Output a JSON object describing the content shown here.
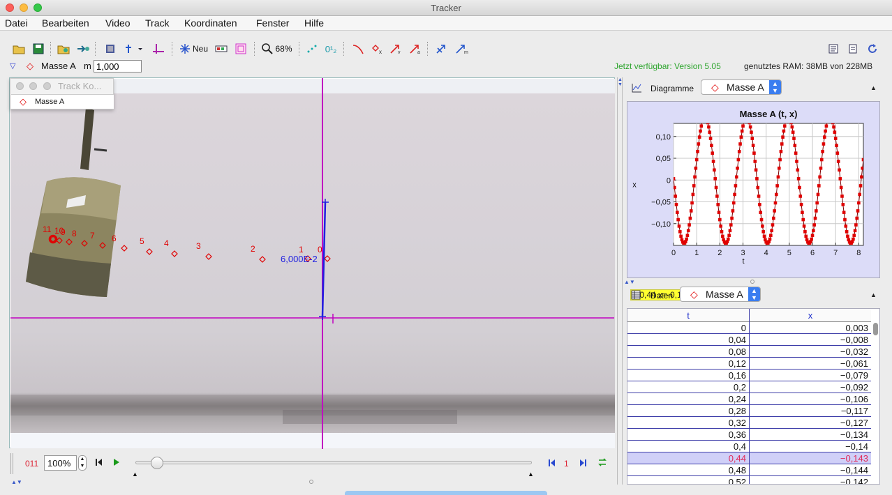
{
  "window": {
    "title": "Tracker"
  },
  "menu": [
    "Datei",
    "Bearbeiten",
    "Video",
    "Track",
    "Koordinaten",
    "Fenster",
    "Hilfe"
  ],
  "toolbar": {
    "new_label": "Neu",
    "zoom_label": "68%"
  },
  "trackbar": {
    "track_name": "Masse A",
    "mass_label": "m",
    "mass_value": "1,000",
    "update_text": "Jetzt verfügbar: Version 5.05",
    "ram_text": "genutztes RAM: 38MB von 228MB"
  },
  "track_control": {
    "title": "Track Ko...",
    "item": "Masse A"
  },
  "video": {
    "point_labels": [
      "11",
      "10",
      "9",
      "8",
      "7",
      "6",
      "5",
      "4",
      "3",
      "2",
      "1",
      "0"
    ],
    "calibration_label": "6,000E-2"
  },
  "player": {
    "frame": "011",
    "zoom": "100%",
    "step": "1"
  },
  "plot_panel": {
    "label": "Diagramme",
    "track": "Masse A",
    "readout": "t=0,44  x=-0,14"
  },
  "table_panel": {
    "label": "Daten",
    "track": "Masse A",
    "columns": [
      "t",
      "x"
    ],
    "rows": [
      [
        "0",
        "0,003"
      ],
      [
        "0,04",
        "−0,008"
      ],
      [
        "0,08",
        "−0,032"
      ],
      [
        "0,12",
        "−0,061"
      ],
      [
        "0,16",
        "−0,079"
      ],
      [
        "0,2",
        "−0,092"
      ],
      [
        "0,24",
        "−0,106"
      ],
      [
        "0,28",
        "−0,117"
      ],
      [
        "0,32",
        "−0,127"
      ],
      [
        "0,36",
        "−0,134"
      ],
      [
        "0,4",
        "−0,14"
      ],
      [
        "0,44",
        "−0,143"
      ],
      [
        "0,48",
        "−0,144"
      ],
      [
        "0,52",
        "−0,142"
      ]
    ],
    "selected_row": 11
  },
  "colors": {
    "accent": "#3a7df0",
    "track_red": "#e00000",
    "axis_magenta": "#c000c0",
    "calib_blue": "#2020e0",
    "update_green": "#2ea52e"
  },
  "chart_data": {
    "type": "scatter",
    "title": "Masse A (t, x)",
    "xlabel": "t",
    "ylabel": "x",
    "xlim": [
      0,
      8.2
    ],
    "ylim": [
      -0.15,
      0.13
    ],
    "xticks": [
      "0",
      "1",
      "2",
      "3",
      "4",
      "5",
      "6",
      "7",
      "8"
    ],
    "yticks": [
      "0,10",
      "0,05",
      "0",
      "−0,05",
      "−0,10"
    ],
    "yticks_values": [
      0.1,
      0.05,
      0,
      -0.05,
      -0.1
    ],
    "amplitude": 0.145,
    "period": 1.8,
    "x0": 0.003,
    "dt": 0.04,
    "grid": true
  }
}
